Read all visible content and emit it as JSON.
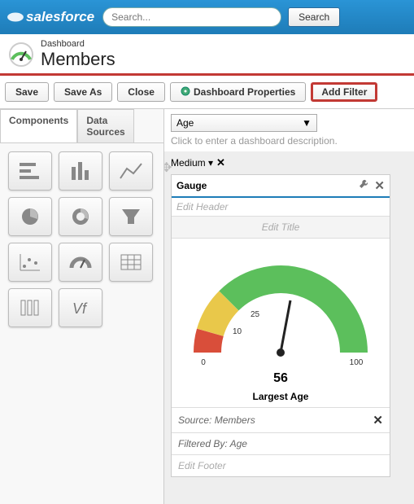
{
  "topbar": {
    "brand": "salesforce",
    "search_placeholder": "Search...",
    "search_button": "Search"
  },
  "header": {
    "breadcrumb": "Dashboard",
    "title": "Members"
  },
  "toolbar": {
    "save": "Save",
    "save_as": "Save As",
    "close": "Close",
    "dashboard_properties": "Dashboard Properties",
    "add_filter": "Add Filter"
  },
  "left_tabs": {
    "components": "Components",
    "data_sources": "Data Sources"
  },
  "component_icons": [
    "bar-horizontal-icon",
    "bar-vertical-icon",
    "line-chart-icon",
    "pie-chart-icon",
    "donut-chart-icon",
    "funnel-chart-icon",
    "scatter-chart-icon",
    "gauge-chart-icon",
    "table-icon",
    "column-table-icon",
    "vf-page-icon"
  ],
  "filter": {
    "selected": "Age"
  },
  "description_placeholder": "Click to enter a dashboard description.",
  "column_size": "Medium",
  "widget": {
    "type_label": "Gauge",
    "header_placeholder": "Edit Header",
    "title_placeholder": "Edit Title",
    "footer_placeholder": "Edit Footer",
    "source_prefix": "Source: ",
    "source_value": "Members",
    "filtered_prefix": "Filtered By:  ",
    "filtered_value": "Age"
  },
  "chart_data": {
    "type": "gauge",
    "min": 0,
    "max": 100,
    "value": 56,
    "title": "Largest Age",
    "bands": [
      {
        "from": 0,
        "to": 10,
        "color": "#d94e3a"
      },
      {
        "from": 10,
        "to": 25,
        "color": "#e9c84a"
      },
      {
        "from": 25,
        "to": 100,
        "color": "#5cbf5c"
      }
    ],
    "tick_values": [
      0,
      10,
      25,
      100
    ]
  }
}
